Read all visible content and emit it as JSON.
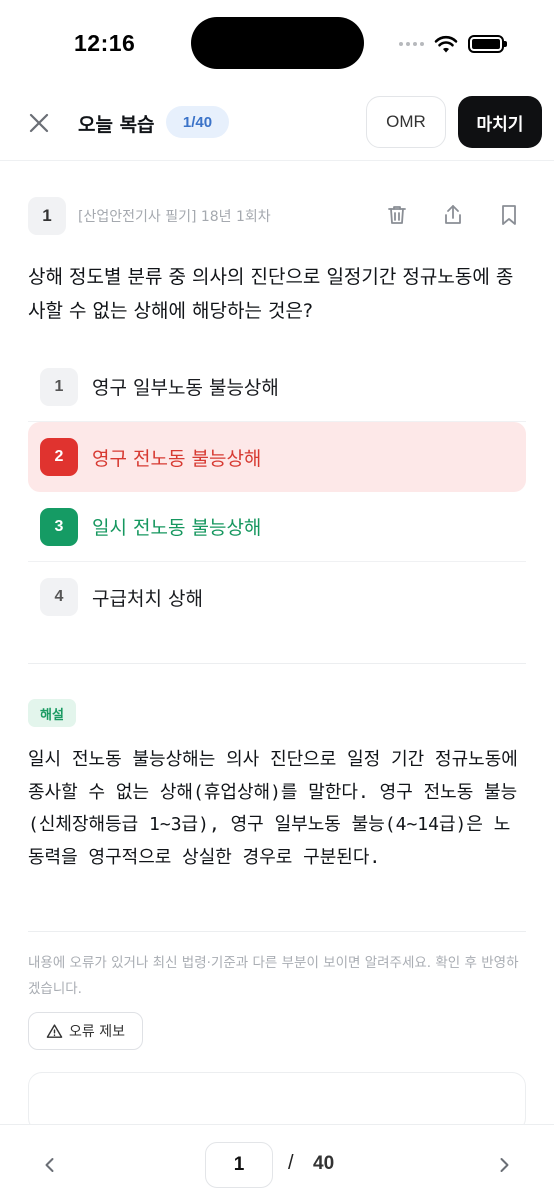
{
  "status_bar": {
    "time": "12:16"
  },
  "header": {
    "title": "오늘 복습",
    "progress": "1/40",
    "omr_label": "OMR",
    "finish_label": "마치기"
  },
  "question": {
    "number": "1",
    "source": "[산업안전기사 필기] 18년 1회차",
    "text": "상해 정도별 분류 중 의사의 진단으로 일정기간 정규노동에 종사할 수 없는 상해에 해당하는 것은?",
    "choices": [
      {
        "num": "1",
        "label": "영구 일부노동 불능상해",
        "state": "default"
      },
      {
        "num": "2",
        "label": "영구 전노동 불능상해",
        "state": "wrong"
      },
      {
        "num": "3",
        "label": "일시 전노동 불능상해",
        "state": "correct"
      },
      {
        "num": "4",
        "label": "구급처치 상해",
        "state": "default"
      }
    ]
  },
  "explanation": {
    "tag": "해설",
    "text": "일시 전노동 불능상해는 의사 진단으로 일정 기간 정규노동에 종사할 수 없는 상해(휴업상해)를 말한다. 영구 전노동 불능(신체장해등급 1~3급), 영구 일부노동 불능(4~14급)은 노동력을 영구적으로 상실한 경우로 구분된다."
  },
  "notice": {
    "text": "내용에 오류가 있거나 최신 법령·기준과 다른 부분이 보이면 알려주세요. 확인 후 반영하겠습니다.",
    "report_label": "오류 제보"
  },
  "pagination": {
    "current": "1",
    "separator": "/",
    "total": "40"
  },
  "colors": {
    "accent_blue": "#3b73c8",
    "wrong_red": "#e0332f",
    "correct_green": "#159b64",
    "dark_button": "#0f1012"
  }
}
